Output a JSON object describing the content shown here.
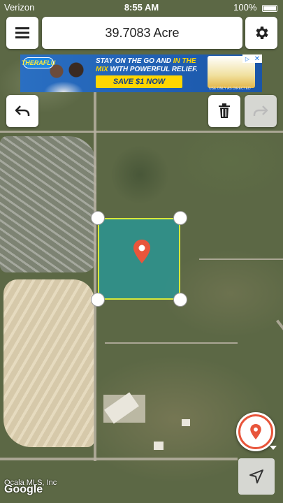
{
  "status_bar": {
    "carrier": "Verizon",
    "time": "8:55 AM",
    "battery": "100%"
  },
  "toolbar": {
    "menu_icon": "hamburger-menu-icon",
    "title": "39.7083 Acre",
    "settings_icon": "gear-icon"
  },
  "ad": {
    "brand": "THERAFLU",
    "headline_1": "STAY ON THE GO AND ",
    "headline_highlight": "IN THE MIX",
    "headline_2": " WITH POWERFUL RELIEF.",
    "cta": "SAVE $1 NOW",
    "fine_print": "USE ONLY AS DIRECTED",
    "adchoices_icon": "adchoices-icon",
    "close_icon": "close-icon"
  },
  "actions": {
    "undo_icon": "undo-arrow-icon",
    "delete_icon": "trash-icon",
    "redo_icon": "redo-arrow-icon"
  },
  "map": {
    "polygon_fill": "#00bcd4",
    "polygon_stroke": "#d8e83a",
    "pin_color": "#e8553b",
    "vertices": [
      "top-left",
      "top-right",
      "bottom-left",
      "bottom-right"
    ]
  },
  "footer": {
    "copyright": "Ocala MLS, Inc",
    "google": "Google",
    "locate_icon": "map-pin-icon",
    "navigate_icon": "navigation-arrow-icon"
  }
}
